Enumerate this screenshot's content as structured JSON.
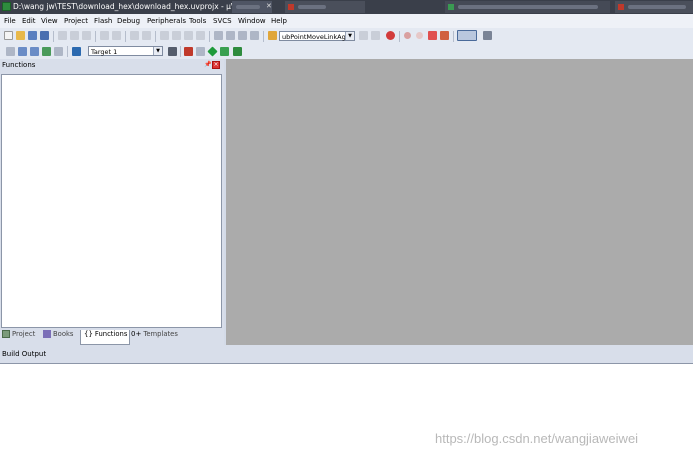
{
  "window": {
    "title": "D:\\wang jw\\TEST\\download_hex\\download_hex.uvprojx - µVision",
    "app_icon": "keil-uvision-icon"
  },
  "menu": [
    "File",
    "Edit",
    "View",
    "Project",
    "Flash",
    "Debug",
    "Peripherals",
    "Tools",
    "SVCS",
    "Window",
    "Help"
  ],
  "toolbar": {
    "find_combo_value": "ubPointMoveLinkAg",
    "target_combo_value": "Target 1"
  },
  "functions_panel": {
    "title": "Functions",
    "tabs": [
      {
        "label": "Project",
        "icon": "project-icon",
        "active": false
      },
      {
        "label": "Books",
        "icon": "books-icon",
        "active": false
      },
      {
        "label": "Functions",
        "icon": "functions-icon",
        "active": true
      },
      {
        "label": "Templates",
        "icon": "templates-icon",
        "active": false
      }
    ]
  },
  "build_output": {
    "title": "Build Output"
  },
  "watermark": "https://blog.csdn.net/wangjiaweiwei",
  "colors": {
    "editor_bg": "#ababab",
    "panel_bg": "#d8deea",
    "titlebar": "#3a3f4a"
  }
}
